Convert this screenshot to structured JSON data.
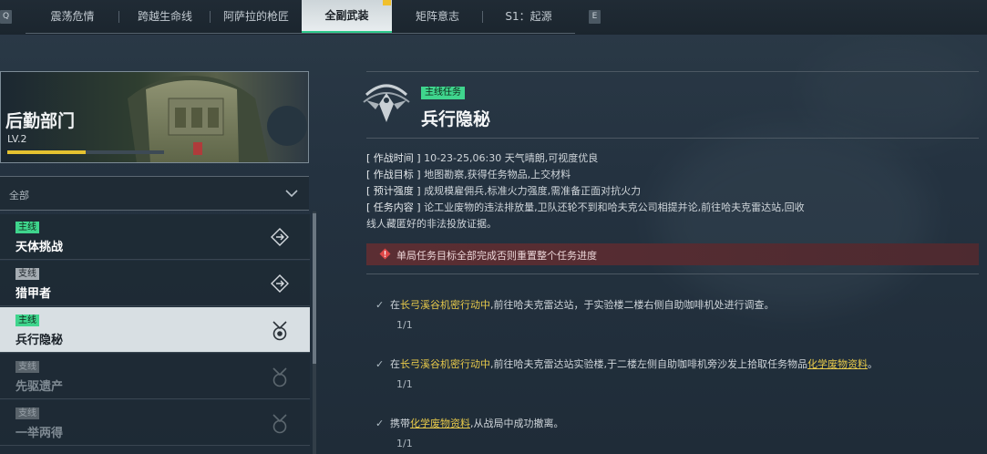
{
  "topbar": {
    "left_key": "Q",
    "right_key": "E",
    "tabs": [
      {
        "label": "震荡危情"
      },
      {
        "label": "跨越生命线"
      },
      {
        "label": "阿萨拉的枪匠"
      },
      {
        "label": "全副武装",
        "active": true
      },
      {
        "label": "矩阵意志"
      },
      {
        "label": "S1：起源"
      }
    ]
  },
  "department": {
    "title": "后勤部门",
    "level": "LV.2",
    "progress": 0.5
  },
  "filter": {
    "selected": "全部"
  },
  "missions": [
    {
      "tag": "主线",
      "name": "天体挑战",
      "type": "main"
    },
    {
      "tag": "支线",
      "name": "猎甲者",
      "type": "side"
    },
    {
      "tag": "主线",
      "name": "兵行隐秘",
      "type": "main",
      "active": true
    },
    {
      "tag": "支线",
      "name": "先驱遗产",
      "type": "side",
      "dim": true
    },
    {
      "tag": "支线",
      "name": "一举两得",
      "type": "side",
      "dim": true
    }
  ],
  "detail": {
    "tag": "主线任务",
    "title": "兵行隐秘",
    "info": [
      {
        "label": "[ 作战时间 ]",
        "text": "10-23-25,06:30 天气晴朗,可视度优良"
      },
      {
        "label": "[ 作战目标 ]",
        "text": "地图勘察,获得任务物品,上交材料"
      },
      {
        "label": "[ 预计强度 ]",
        "text": "成规模雇佣兵,标准火力强度,需准备正面对抗火力"
      },
      {
        "label": "[ 任务内容 ]",
        "text": "论工业废物的违法排放量,卫队还轮不到和哈夫克公司相提并论,前往哈夫克雷达站,回收"
      }
    ],
    "info_cont": "线人藏匿好的非法投放证据。",
    "warning": "单局任务目标全部完成否则重置整个任务进度",
    "objectives": [
      {
        "pre": "在",
        "hl1": "长弓溪谷机密行动中",
        "mid": ",前往哈夫克雷达站，于实验楼二楼右侧自助咖啡机处进行调查。",
        "hl2": "",
        "post": "",
        "progress": "1/1"
      },
      {
        "pre": "在",
        "hl1": "长弓溪谷机密行动中",
        "mid": ",前往哈夫克雷达站实验楼,于二楼左侧自助咖啡机旁沙发上拾取任务物品",
        "hl2": "化学废物资料",
        "post": "。",
        "progress": "1/1"
      },
      {
        "pre": "携带",
        "hl1": "",
        "mid": "",
        "hl2": "化学废物资料",
        "post": ",从战局中成功撤离。",
        "progress": "1/1"
      }
    ]
  },
  "colors": {
    "accent_green": "#3fd58d",
    "progress_yellow": "#e5c230",
    "warning_red": "#e04848"
  }
}
